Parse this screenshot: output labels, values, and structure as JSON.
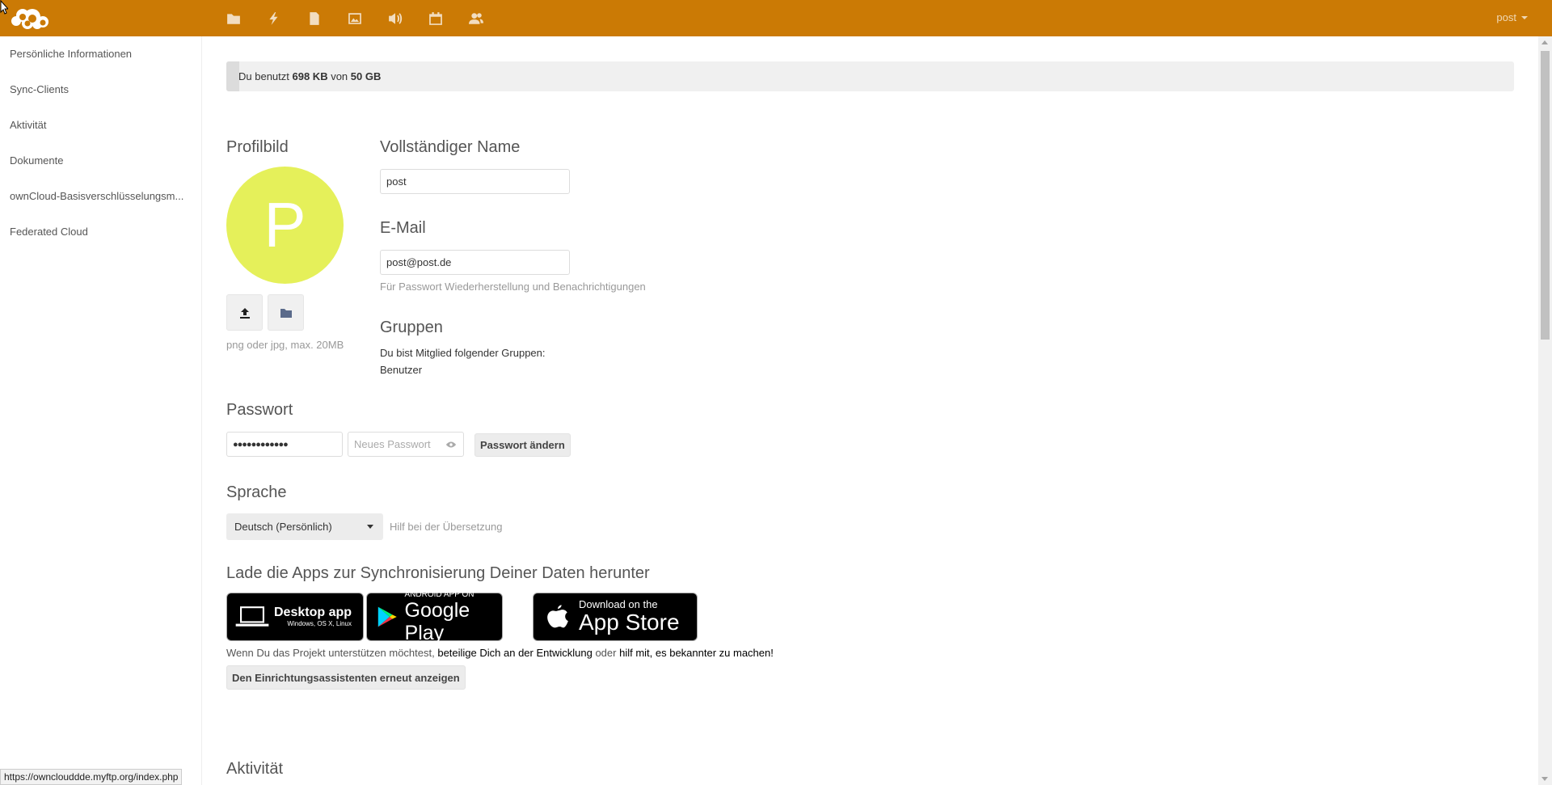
{
  "header": {
    "user_label": "post",
    "colors": {
      "background": "#cb7a05"
    },
    "apps": [
      {
        "icon": "folder-icon"
      },
      {
        "icon": "activity-icon"
      },
      {
        "icon": "document-icon"
      },
      {
        "icon": "image-icon"
      },
      {
        "icon": "audio-icon"
      },
      {
        "icon": "calendar-icon"
      },
      {
        "icon": "contacts-icon"
      }
    ]
  },
  "sidebar": {
    "items": [
      {
        "label": "Persönliche Informationen"
      },
      {
        "label": "Sync-Clients"
      },
      {
        "label": "Aktivität"
      },
      {
        "label": "Dokumente"
      },
      {
        "label": "ownCloud-Basisverschlüsselungsm..."
      },
      {
        "label": "Federated Cloud"
      }
    ]
  },
  "quota": {
    "prefix": "Du benutzt ",
    "used": "698 KB",
    "middle": " von ",
    "total": "50 GB",
    "fill_fraction": 0.01
  },
  "profile": {
    "profilbild_title": "Profilbild",
    "avatar_letter": "P",
    "avatar_color": "#e5f05a",
    "avatar_hint": "png oder jpg, max. 20MB",
    "fullname_title": "Vollständiger Name",
    "fullname_value": "post",
    "email_title": "E-Mail",
    "email_value": "post@post.de",
    "email_hint": "Für Passwort Wiederherstellung und Benachrichtigungen",
    "groups_title": "Gruppen",
    "groups_text": "Du bist Mitglied folgender Gruppen:",
    "groups_value": "Benutzer"
  },
  "password": {
    "title": "Passwort",
    "current_value": "●●●●●●●●●●●●",
    "new_placeholder": "Neues Passwort",
    "change_label": "Passwort ändern"
  },
  "language": {
    "title": "Sprache",
    "selected": "Deutsch (Persönlich)",
    "help_link": "Hilf bei der Übersetzung"
  },
  "apps_section": {
    "title": "Lade die Apps zur Synchronisierung Deiner Daten herunter",
    "desktop": {
      "main": "Desktop app",
      "sub": "Windows, OS X, Linux"
    },
    "android": {
      "top": "ANDROID APP ON",
      "main": "Google Play"
    },
    "ios": {
      "top": "Download on the",
      "main": "App Store"
    },
    "support_prefix": "Wenn Du das Projekt unterstützen möchtest, ",
    "support_link1": "beteilige Dich an der Entwicklung",
    "support_mid": " oder ",
    "support_link2": "hilf mit, es bekannter zu machen",
    "support_suffix": "!",
    "wizard_label": "Den Einrichtungsassistenten erneut anzeigen"
  },
  "activity": {
    "title": "Aktivität"
  },
  "statusbar": {
    "url": "https://ownclouddde.myftp.org/index.php"
  }
}
